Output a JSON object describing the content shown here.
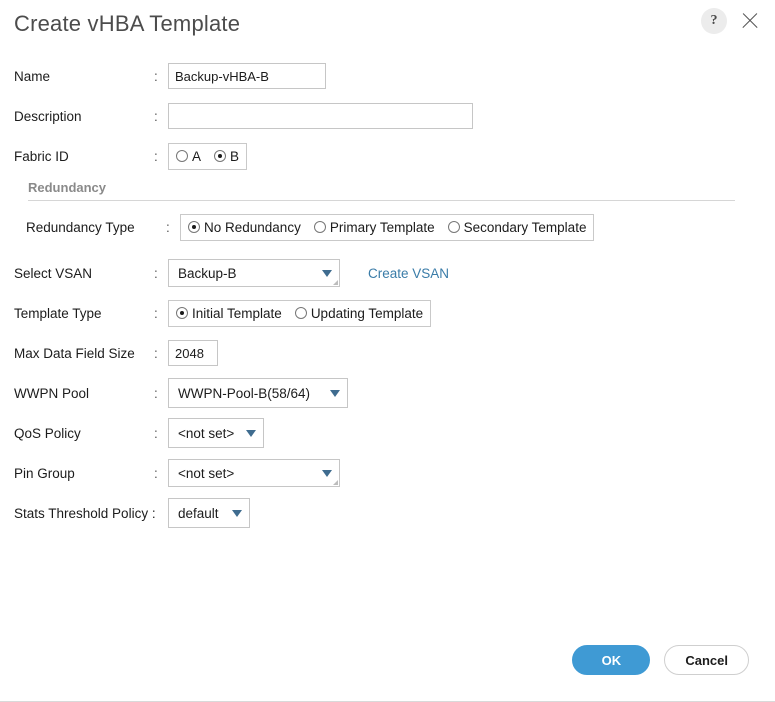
{
  "dialog": {
    "title": "Create vHBA Template",
    "help_icon_label": "?",
    "close_icon_label": "×"
  },
  "fields": {
    "name": {
      "label": "Name",
      "separator": ":",
      "value": "Backup-vHBA-B",
      "placeholder": ""
    },
    "description": {
      "label": "Description",
      "separator": ":",
      "value": "",
      "placeholder": ""
    },
    "fabric_id": {
      "label": "Fabric ID",
      "separator": ":",
      "options": [
        {
          "label": "A",
          "checked": false
        },
        {
          "label": "B",
          "checked": true
        }
      ]
    },
    "redundancy_type": {
      "label": "Redundancy Type",
      "separator": ":",
      "options": [
        {
          "label": "No Redundancy",
          "checked": true
        },
        {
          "label": "Primary Template",
          "checked": false
        },
        {
          "label": "Secondary Template",
          "checked": false
        }
      ]
    },
    "select_vsan": {
      "label": "Select VSAN",
      "separator": ":",
      "value": "Backup-B",
      "link_label": "Create VSAN"
    },
    "template_type": {
      "label": "Template Type",
      "separator": ":",
      "options": [
        {
          "label": "Initial Template",
          "checked": true
        },
        {
          "label": "Updating Template",
          "checked": false
        }
      ]
    },
    "max_data_field_size": {
      "label": "Max Data Field Size",
      "separator": ":",
      "value": "2048"
    },
    "wwpn_pool": {
      "label": "WWPN Pool",
      "separator": ":",
      "value": "WWPN-Pool-B(58/64)"
    },
    "qos_policy": {
      "label": "QoS Policy",
      "separator": ":",
      "value": "<not set>"
    },
    "pin_group": {
      "label": "Pin Group",
      "separator": ":",
      "value": "<not set>"
    },
    "stats_threshold_policy": {
      "label": "Stats Threshold Policy :",
      "value": "default"
    }
  },
  "sections": {
    "redundancy": {
      "title": "Redundancy"
    }
  },
  "footer": {
    "ok_label": "OK",
    "cancel_label": "Cancel"
  },
  "colors": {
    "primary_button": "#3f9ad4",
    "link": "#3a7ca8",
    "caret": "#3f6c8f",
    "section_title": "#8a8a8a",
    "title": "#4c4c4c"
  }
}
